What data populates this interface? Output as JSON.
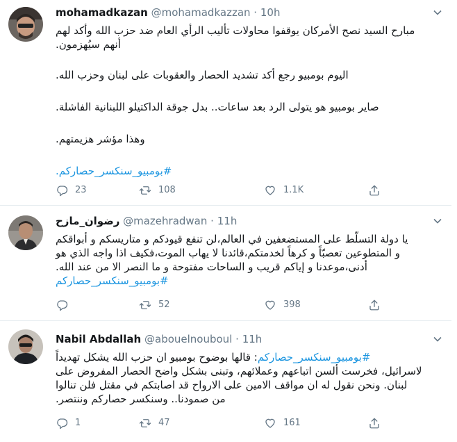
{
  "tweets": [
    {
      "name": "mohamadkazan",
      "handle": "@mohamadkazzan",
      "separator": "·",
      "time": "10h",
      "lines": [
        "مبارح السيد نصح الأمركان يوقفوا محاولات تأليب الرأي العام ضد حزب الله وأكد لهم",
        "أنهم سيُهزمون.",
        "",
        "اليوم بومبيو رجع أكد تشديد الحصار والعقوبات على لبنان وحزب الله.",
        "",
        "صاير بومبيو هو يتولى الرد بعد ساعات.. بدل جوقة الداكتيلو اللبنانية الفاشلة.",
        "",
        "وهذا مؤشر هزيمتهم."
      ],
      "hashtag": "#بومبيو_سنكسر_حصاركم.",
      "replies": "23",
      "retweets": "108",
      "likes": "1.1K"
    },
    {
      "name": "رضوان_مازح",
      "handle": "@mazehradwan",
      "separator": "·",
      "time": "11h",
      "lines": [
        "يا دولة التسلّط على المستضعفين في العالم،لن تنفع قيودكم و متاريسكم و أبواقكم",
        "و المتطوعين تعصبّاً و كرهاً لخدمتكم،قائدنا لا يهاب الموت،فكيف اذا واجه الذي هو",
        "أدنى،موعدنا و إياكم قريب و الساحات مفتوحة و ما النصر الا من عند الله."
      ],
      "hashtag": "#بومبيو_سنكسر_حصاركم",
      "replies": "",
      "retweets": "52",
      "likes": "398"
    },
    {
      "name": "Nabil Abdallah",
      "handle": "@abouelnouboul",
      "separator": "·",
      "time": "11h",
      "hashtag": "#بومبيو_سنكسر_حصاركم",
      "first_line_text": ": قالها بوضوح بومبيو ان حزب الله يشكل تهديداً",
      "lines": [
        "لاسرائيل، فخرست ألسن اتباعهم وعملائهم، وتبنى بشكل واضح الحصار المفروض على",
        "لبنان. ونحن نقول له ان مواقف الامين على الارواح قد اصابتكم في مقتل فلن تنالوا",
        "من صمودنا.. وسنكسر حصاركم وننتصر."
      ],
      "replies": "1",
      "retweets": "47",
      "likes": "161"
    }
  ],
  "colors": {
    "text": "#14171a",
    "secondary": "#657786",
    "link": "#1b95e0",
    "divider": "#e6ecf0"
  }
}
